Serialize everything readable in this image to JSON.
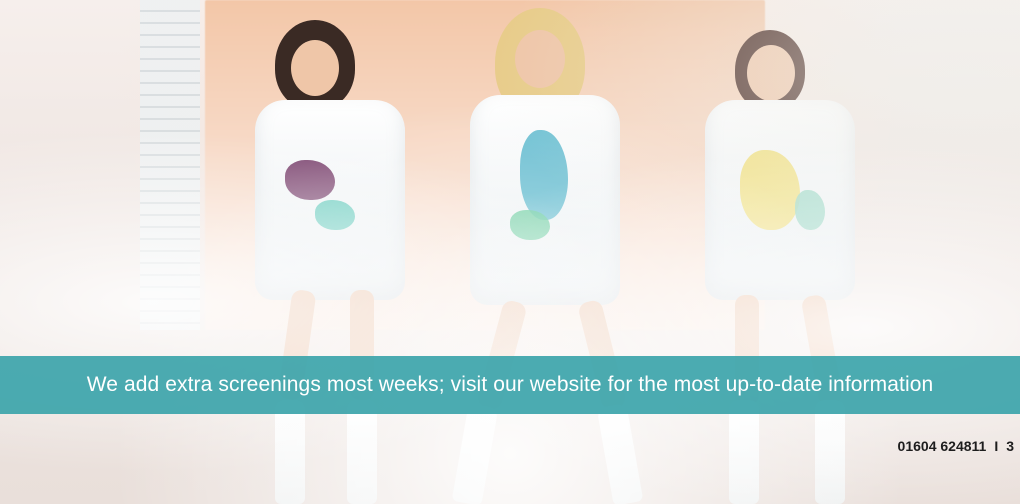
{
  "banner": {
    "text": "We add extra screenings most weeks; visit our website for the most up-to-date information",
    "color": "#3ca4aa"
  },
  "footer": {
    "phone": "01604 624811",
    "separator": "I",
    "page_number": "3"
  },
  "photo": {
    "subject": "three-singers-photo"
  }
}
